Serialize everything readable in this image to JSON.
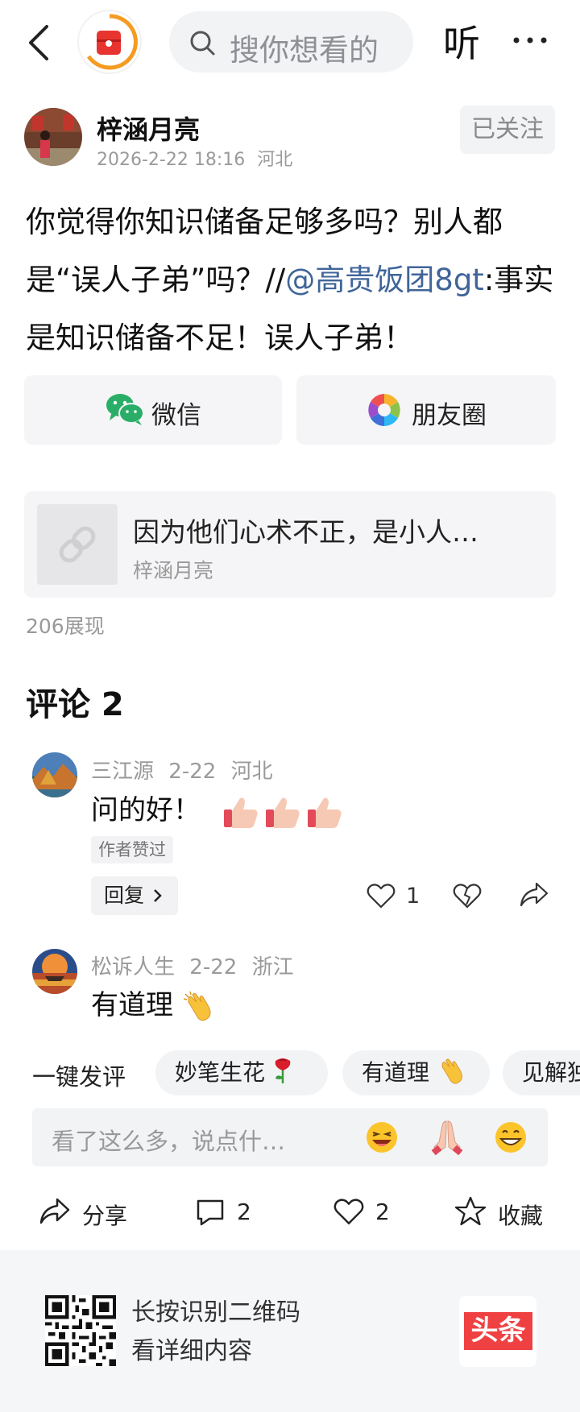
{
  "header": {
    "search_placeholder": "搜你想看的",
    "listen_label": "听"
  },
  "author": {
    "name": "梓涵月亮",
    "date": "2026-2-22 18:16",
    "location": "河北",
    "follow_label": "已关注"
  },
  "post": {
    "text_before": "你觉得你知识储备足够多吗？别人都是“误人子弟”吗？//",
    "mention": "@高贵饭团8gt",
    "text_after": ":事实是知识储备不足！误人子弟！"
  },
  "share": {
    "wechat_label": "微信",
    "moments_label": "朋友圈"
  },
  "link_card": {
    "title": "因为他们心术不正，是小人…",
    "author": "梓涵月亮"
  },
  "views": "206展现",
  "comments": {
    "title": "评论 2",
    "items": [
      {
        "user": "三江源",
        "date": "2-22",
        "location": "河北",
        "text": "问的好！",
        "badge": "作者赞过",
        "reply_label": "回复",
        "likes": "1"
      },
      {
        "user": "松诉人生",
        "date": "2-22",
        "location": "浙江",
        "text": "有道理"
      }
    ]
  },
  "quick_comments": {
    "label": "一键发评",
    "chips": [
      "妙笔生花",
      "有道理",
      "见解独到"
    ]
  },
  "input": {
    "placeholder": "看了这么多，说点什…"
  },
  "actions": {
    "share": "分享",
    "comments": "2",
    "likes": "2",
    "favorite": "收藏"
  },
  "footer": {
    "line1": "长按识别二维码",
    "line2": "看详细内容",
    "brand": "头条"
  }
}
